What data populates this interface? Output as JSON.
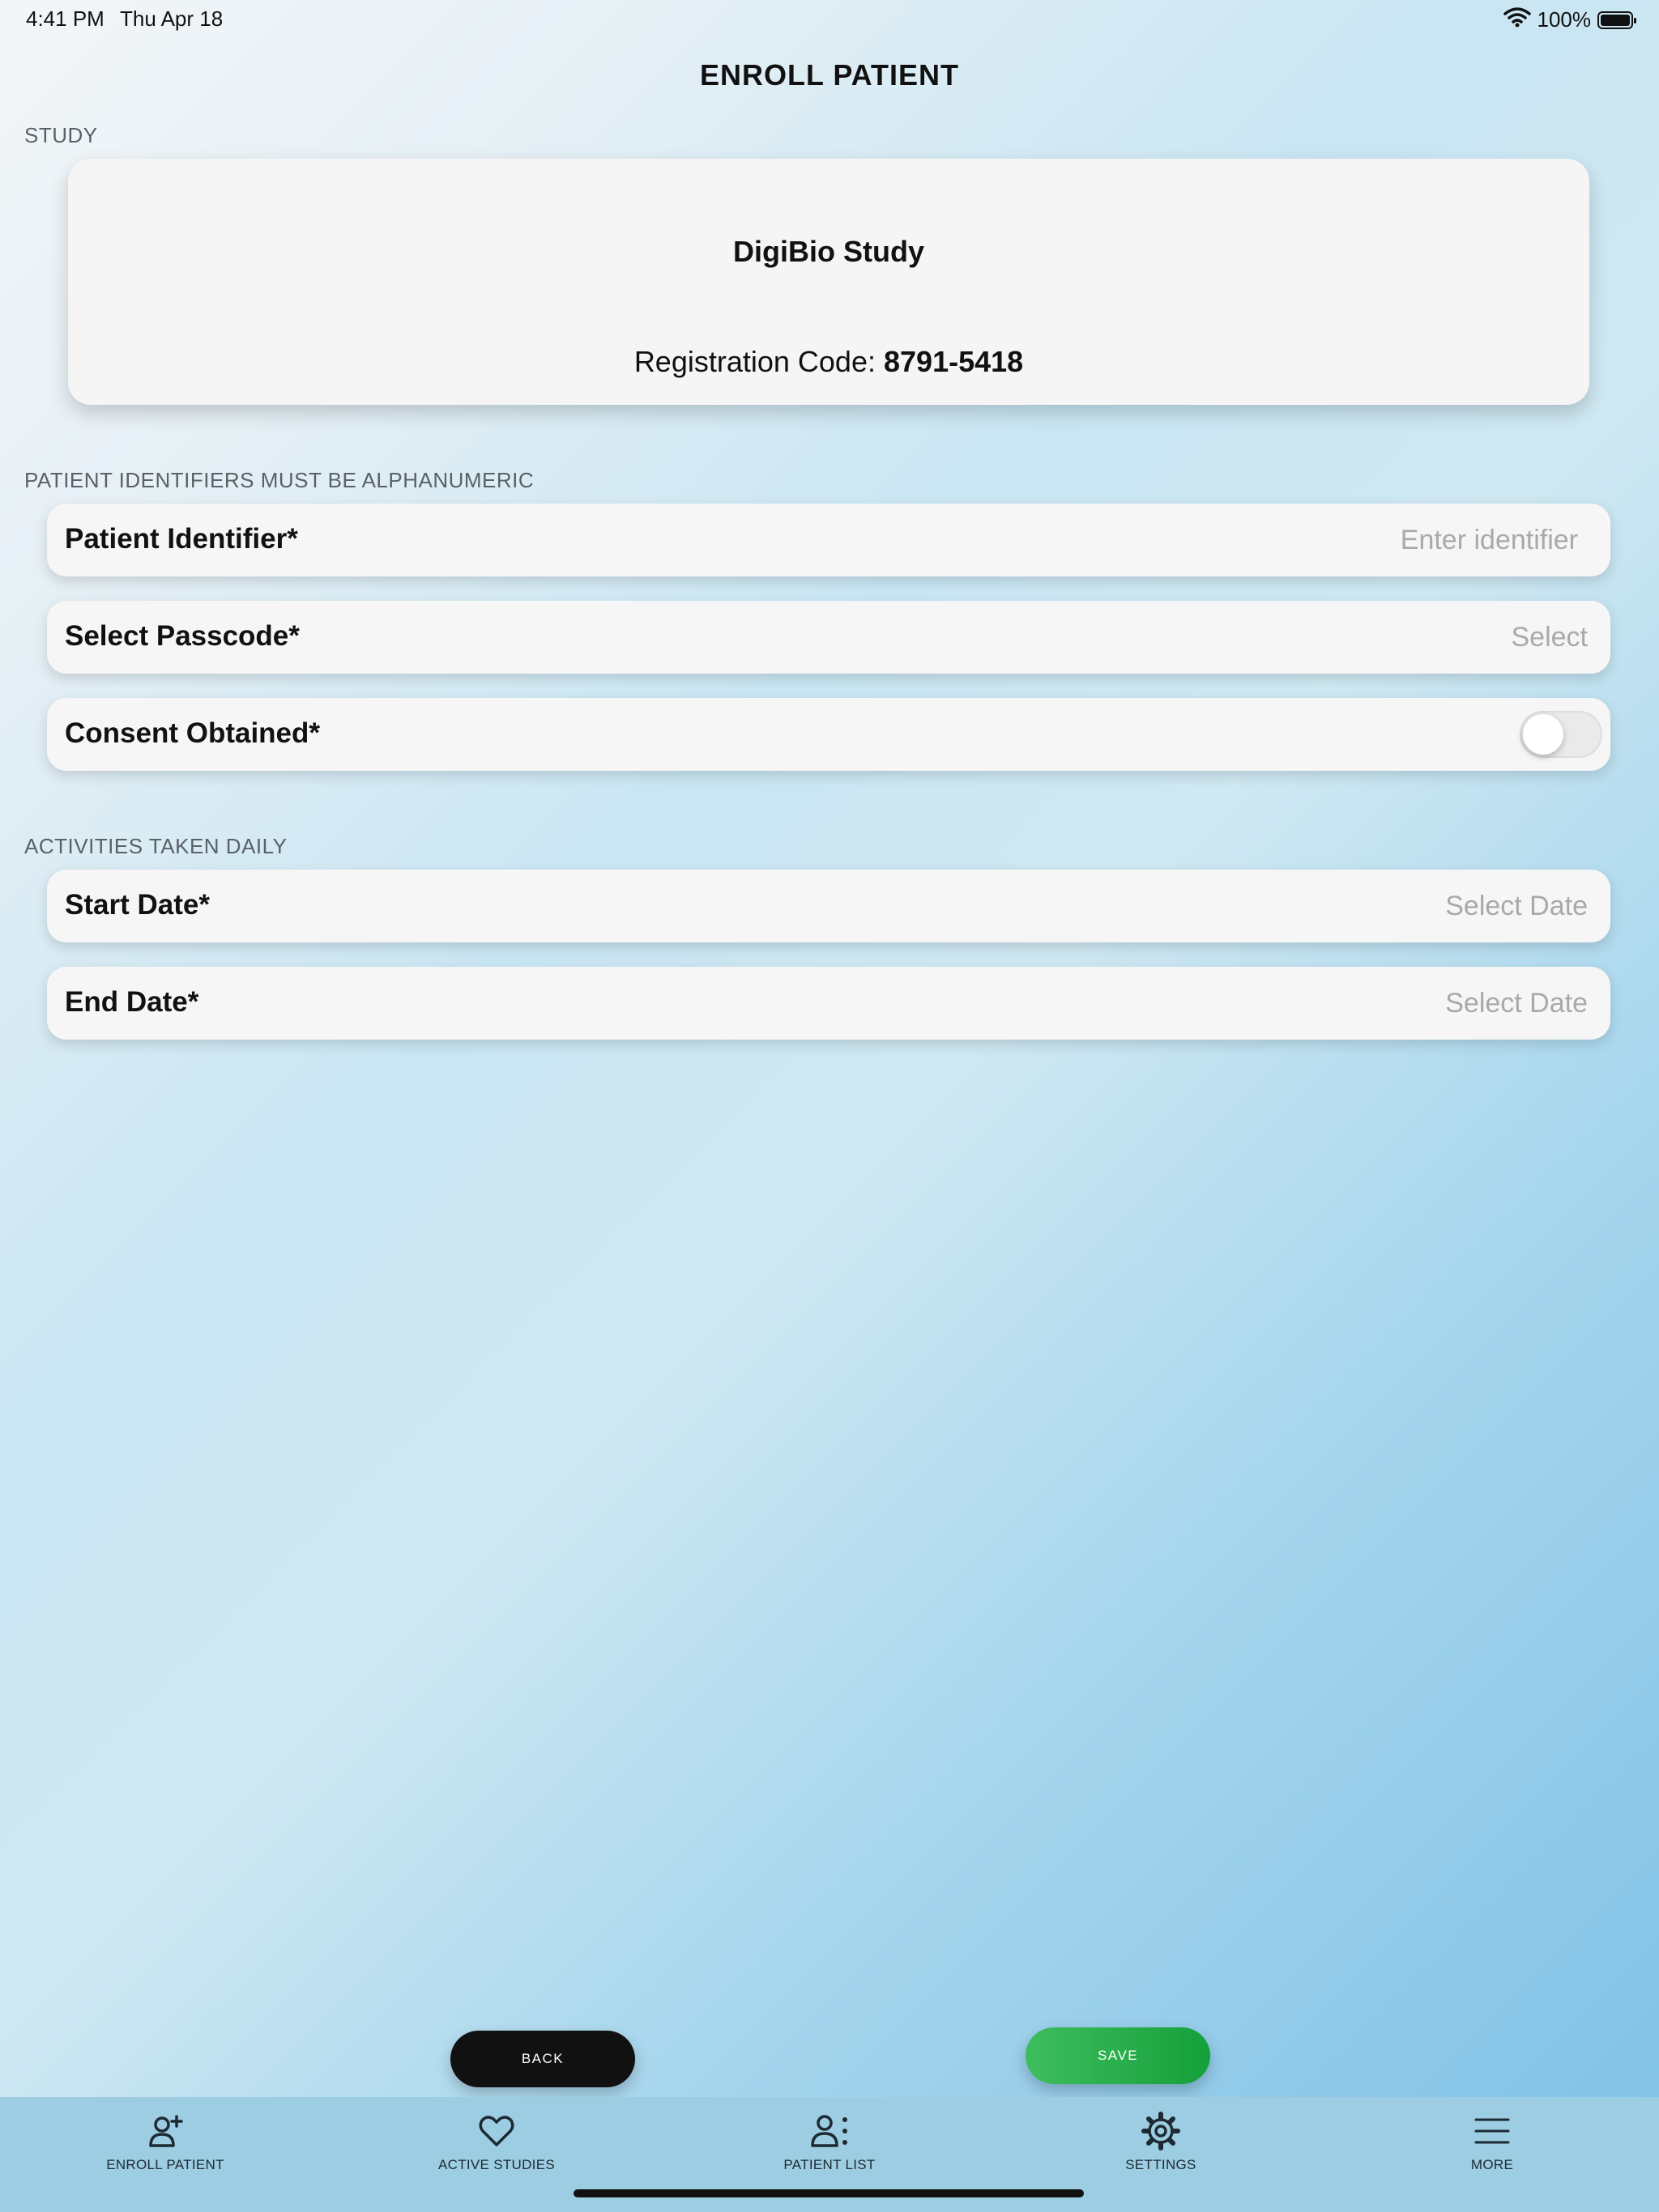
{
  "status_bar": {
    "time": "4:41 PM",
    "date": "Thu Apr 18",
    "battery": "100%"
  },
  "page": {
    "title": "ENROLL PATIENT"
  },
  "study_section": {
    "header": "STUDY",
    "study_name": "DigiBio Study",
    "registration_label": "Registration Code:",
    "registration_code": "8791-5418"
  },
  "identifier_section": {
    "header": "PATIENT IDENTIFIERS MUST BE ALPHANUMERIC",
    "patient_identifier": {
      "label": "Patient Identifier*",
      "placeholder": "Enter identifier"
    },
    "passcode": {
      "label": "Select Passcode*",
      "value": "Select"
    },
    "consent": {
      "label": "Consent Obtained*",
      "on": false
    }
  },
  "activities_section": {
    "header": "ACTIVITIES TAKEN DAILY",
    "start_date": {
      "label": "Start Date*",
      "value": "Select Date"
    },
    "end_date": {
      "label": "End Date*",
      "value": "Select Date"
    }
  },
  "actions": {
    "back": "BACK",
    "save": "SAVE"
  },
  "tabs": [
    {
      "label": "ENROLL PATIENT",
      "icon": "add-user-icon"
    },
    {
      "label": "ACTIVE STUDIES",
      "icon": "heart-icon"
    },
    {
      "label": "PATIENT LIST",
      "icon": "user-list-icon"
    },
    {
      "label": "SETTINGS",
      "icon": "gear-icon"
    },
    {
      "label": "MORE",
      "icon": "menu-icon"
    }
  ],
  "colors": {
    "save": "#14a03a",
    "back": "#111111",
    "tab_bar": "#9ccde2"
  }
}
